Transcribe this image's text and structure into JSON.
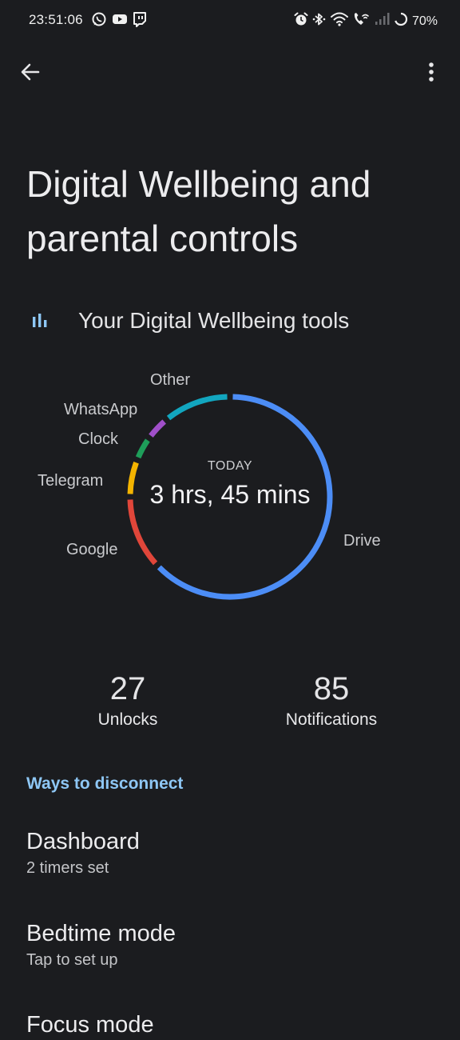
{
  "status_bar": {
    "time": "23:51:06",
    "battery": "70%",
    "left_icons": [
      "whatsapp-icon",
      "youtube-icon",
      "twitch-icon"
    ],
    "right_icons": [
      "alarm-icon",
      "bluetooth-icon",
      "wifi-icon",
      "wifi-calling-icon",
      "signal-icon",
      "battery-ring-icon"
    ]
  },
  "app_bar": {
    "back_icon": "arrow-back-icon",
    "menu_icon": "more-vert-icon"
  },
  "page": {
    "title": "Digital Wellbeing and parental controls"
  },
  "tools": {
    "icon": "bar-chart-icon",
    "title": "Your Digital Wellbeing tools",
    "accent_color": "#8ec7f5"
  },
  "usage_ring": {
    "caption": "TODAY",
    "total": "3 hrs, 45 mins",
    "segments": [
      {
        "label": "Drive",
        "fraction": 0.63,
        "color": "#4c8df6"
      },
      {
        "label": "Google",
        "fraction": 0.12,
        "color": "#e0463a"
      },
      {
        "label": "Telegram",
        "fraction": 0.06,
        "color": "#f4b400"
      },
      {
        "label": "Clock",
        "fraction": 0.04,
        "color": "#1e9e5a"
      },
      {
        "label": "WhatsApp",
        "fraction": 0.04,
        "color": "#a04fc9"
      },
      {
        "label": "Other",
        "fraction": 0.11,
        "color": "#12a6bf"
      }
    ]
  },
  "stats": {
    "unlocks_value": "27",
    "unlocks_label": "Unlocks",
    "notifications_value": "85",
    "notifications_label": "Notifications"
  },
  "ways": {
    "header": "Ways to disconnect",
    "items": [
      {
        "title": "Dashboard",
        "subtitle": "2 timers set"
      },
      {
        "title": "Bedtime mode",
        "subtitle": "Tap to set up"
      },
      {
        "title": "Focus mode",
        "subtitle": ""
      }
    ]
  }
}
